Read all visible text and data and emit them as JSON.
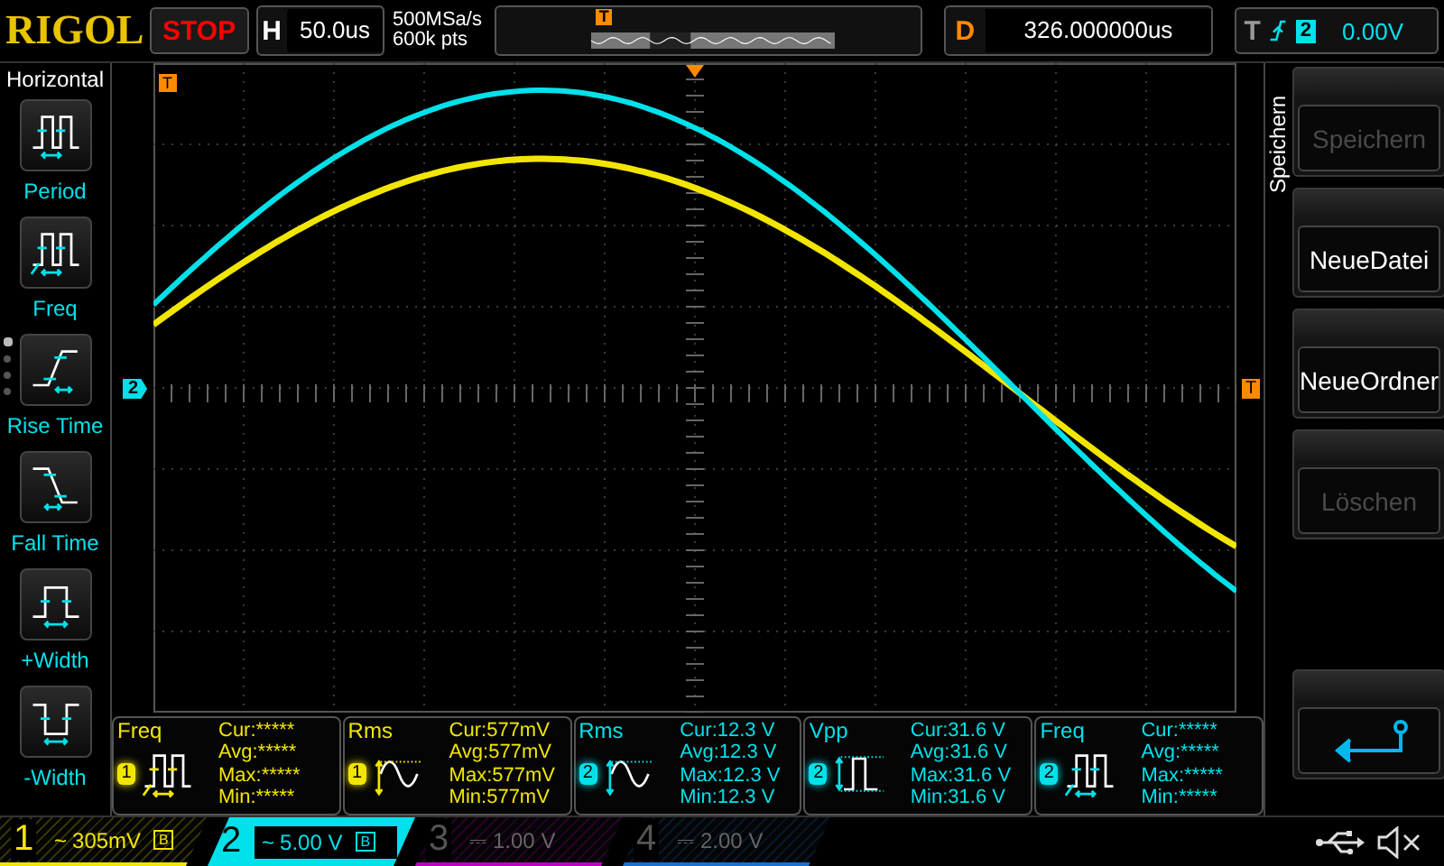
{
  "top_bar": {
    "logo": "RIGOL",
    "run_state": "STOP",
    "horizontal": {
      "label": "H",
      "timebase": "50.0us"
    },
    "sample_rate": "500MSa/s",
    "memory_depth": "600k pts",
    "trigger_position_marker": "T",
    "delay": {
      "label": "D",
      "value": "326.000000us"
    },
    "trigger": {
      "label": "T",
      "source": "2",
      "level": "0.00V"
    }
  },
  "left_menu": {
    "title": "Horizontal",
    "items": [
      {
        "label": "Period",
        "kind": "period"
      },
      {
        "label": "Freq",
        "kind": "freq"
      },
      {
        "label": "Rise Time",
        "kind": "rise"
      },
      {
        "label": "Fall Time",
        "kind": "fall"
      },
      {
        "label": "+Width",
        "kind": "pos_width"
      },
      {
        "label": "-Width",
        "kind": "neg_width"
      }
    ],
    "page_dots": [
      {
        "selected": true
      },
      {
        "selected": false
      },
      {
        "selected": false
      },
      {
        "selected": false
      }
    ]
  },
  "plot": {
    "left_trigger_marker": "T",
    "channel_marker": "2",
    "trigger_level_marker": "T"
  },
  "measurements": [
    {
      "name": "Freq",
      "channel": "1",
      "color": "#f2e600",
      "kind": "freq",
      "readings": [
        "Cur:*****",
        "Avg:*****",
        "Max:*****",
        "Min:*****"
      ]
    },
    {
      "name": "Rms",
      "channel": "1",
      "color": "#f2e600",
      "kind": "rms",
      "readings": [
        "Cur:577mV",
        "Avg:577mV",
        "Max:577mV",
        "Min:577mV"
      ]
    },
    {
      "name": "Rms",
      "channel": "2",
      "color": "#00e1ea",
      "kind": "rms",
      "readings": [
        "Cur:12.3 V",
        "Avg:12.3 V",
        "Max:12.3 V",
        "Min:12.3 V"
      ]
    },
    {
      "name": "Vpp",
      "channel": "2",
      "color": "#00e1ea",
      "kind": "vpp",
      "readings": [
        "Cur:31.6 V",
        "Avg:31.6 V",
        "Max:31.6 V",
        "Min:31.6 V"
      ]
    },
    {
      "name": "Freq",
      "channel": "2",
      "color": "#00e1ea",
      "kind": "freq",
      "readings": [
        "Cur:*****",
        "Avg:*****",
        "Max:*****",
        "Min:*****"
      ]
    }
  ],
  "right_menu": {
    "title": "Speichern",
    "buttons": [
      {
        "label": "Speichern",
        "disabled": true
      },
      {
        "label": "NeueDatei",
        "disabled": false
      },
      {
        "label": "NeueOrdner",
        "disabled": false
      },
      {
        "label": "Löschen",
        "disabled": true
      }
    ]
  },
  "channels": [
    {
      "number": "1",
      "coupling": "~",
      "scale": "305mV",
      "limit_badge": "B",
      "on": true,
      "selected": false,
      "color": "#f2e600"
    },
    {
      "number": "2",
      "coupling": "~",
      "scale": "5.00 V",
      "limit_badge": "B",
      "on": true,
      "selected": true,
      "color": "#00e1ea"
    },
    {
      "number": "3",
      "coupling": "⎓",
      "scale": "1.00 V",
      "on": false,
      "selected": false,
      "color": "#c000c0"
    },
    {
      "number": "4",
      "coupling": "⎓",
      "scale": "2.00 V",
      "on": false,
      "selected": false,
      "color": "#1870d0"
    }
  ]
}
